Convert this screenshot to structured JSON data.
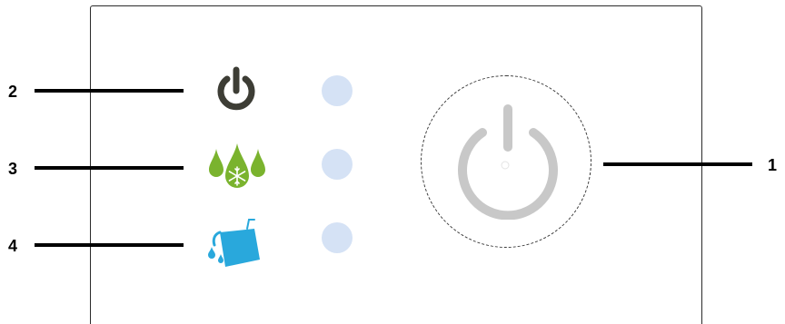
{
  "callouts": {
    "one": "1",
    "two": "2",
    "three": "3",
    "four": "4"
  },
  "icons": {
    "row_2": "power-icon",
    "row_3": "water-drops-snowflake-icon",
    "row_4": "water-tank-icon",
    "main": "power-button-icon"
  },
  "colors": {
    "power_icon": "#3d3d35",
    "drops_green": "#7ab32e",
    "tank_blue": "#29a8dc",
    "led": "#d5e2f5",
    "main_power": "#c8c8c8",
    "callout_line": "#000000"
  }
}
